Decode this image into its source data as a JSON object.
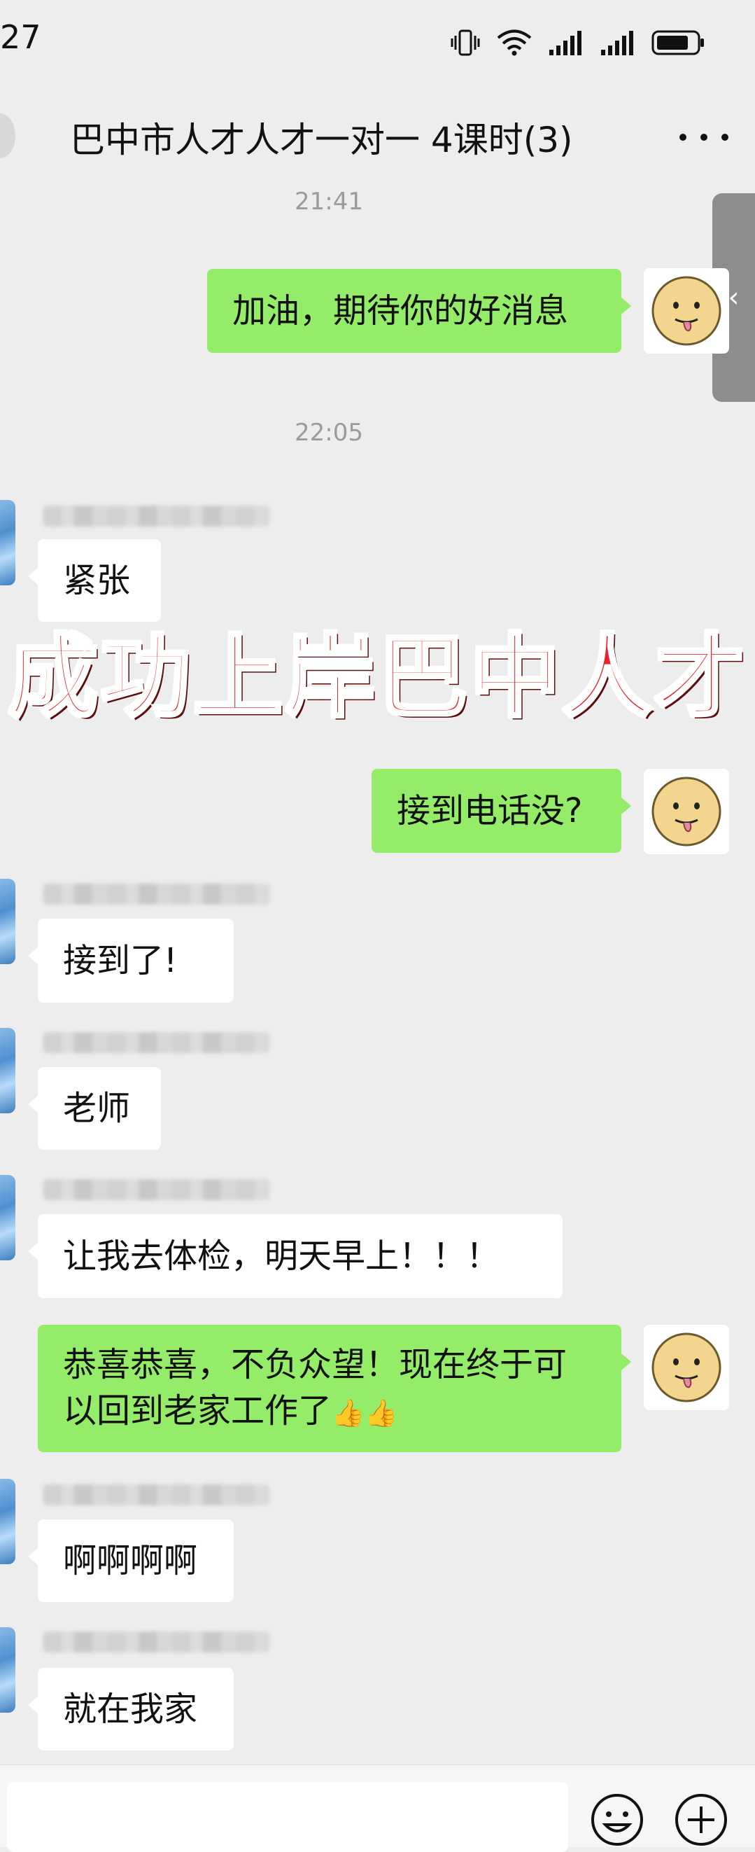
{
  "status_bar": {
    "time": "27"
  },
  "header": {
    "title": "巴中市人才人才一对一 4课时(3)"
  },
  "timestamps": [
    "21:41",
    "22:05"
  ],
  "messages": [
    {
      "side": "out",
      "text": "加油，期待你的好消息"
    },
    {
      "side": "in",
      "text": "紧张"
    },
    {
      "side": "out",
      "text": "接到电话没?"
    },
    {
      "side": "in",
      "text": "接到了!"
    },
    {
      "side": "in",
      "text": "老师"
    },
    {
      "side": "in",
      "text": "让我去体检，明天早上！！！"
    },
    {
      "side": "out",
      "line1": "恭喜恭喜，不负众望！现在终于可",
      "line2": "以回到老家工作了",
      "emoji": "👍👍"
    },
    {
      "side": "in",
      "text": "啊啊啊啊"
    },
    {
      "side": "in",
      "text": "就在我家"
    }
  ],
  "overlay": {
    "text": "成功上岸巴中人才"
  },
  "side_tab": {
    "icon": "‹"
  },
  "colors": {
    "outgoing_bubble": "#95ec69",
    "incoming_bubble": "#ffffff",
    "background": "#ededed",
    "overlay_text": "#e8232b"
  }
}
